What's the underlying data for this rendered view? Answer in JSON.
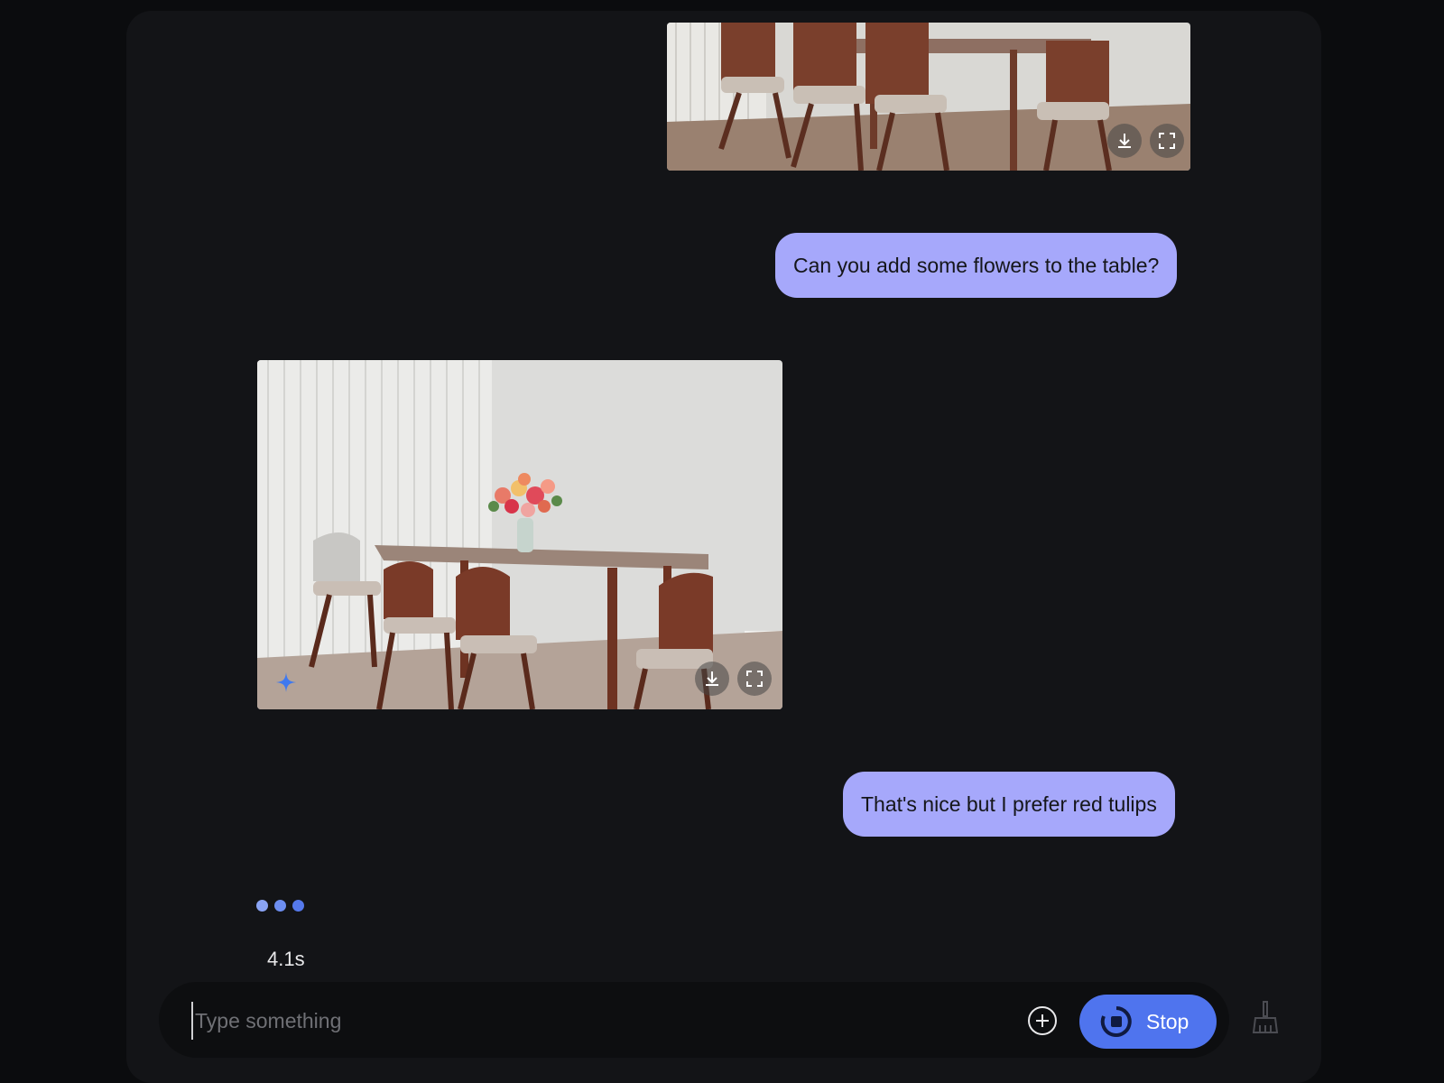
{
  "messages": [
    {
      "role": "user",
      "text": "Can you add some flowers to the table?"
    },
    {
      "role": "user",
      "text": "That's nice but I prefer red tulips"
    }
  ],
  "images": [
    {
      "alt": "Dining room with chairs and table",
      "actions": [
        "download-icon",
        "fullscreen-icon"
      ]
    },
    {
      "alt": "Dining room with flowers on the table",
      "actions": [
        "download-icon",
        "fullscreen-icon"
      ],
      "badge": "sparkle-icon"
    }
  ],
  "status": {
    "elapsed": "4.1s",
    "typing_indicator": "three-dots"
  },
  "composer": {
    "placeholder": "Type something",
    "stop_label": "Stop"
  },
  "colors": {
    "bubble": "#a6a8fb",
    "accent": "#4f74ee",
    "background": "#131417",
    "dot_light": "#8aa4f5",
    "dot_dark": "#5579ec"
  }
}
